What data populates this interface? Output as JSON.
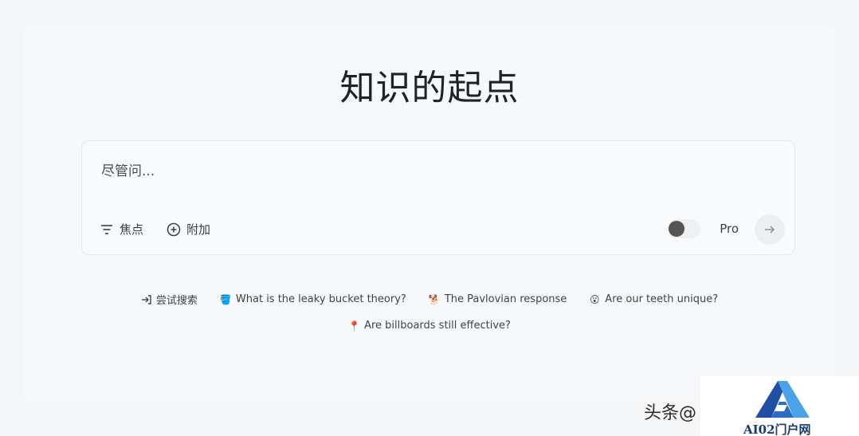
{
  "header": {
    "title": "知识的起点"
  },
  "search": {
    "placeholder": "尽管问...",
    "value": "",
    "focus_label": "焦点",
    "attach_label": "附加",
    "pro_label": "Pro"
  },
  "suggestions": {
    "try_label": "尝试搜索",
    "items": [
      {
        "emoji": "🪣",
        "label": "What is the leaky bucket theory?"
      },
      {
        "emoji": "🐕",
        "label": "The Pavlovian response"
      },
      {
        "emoji": "😮",
        "label": "Are our teeth unique?"
      },
      {
        "emoji": "📍",
        "label": "Are billboards still effective?"
      }
    ]
  },
  "watermark": {
    "toutiao": "头条@",
    "logo_text": "AI02门户网"
  },
  "colors": {
    "background": "#f5f6f7",
    "toggle_knob": "#555555",
    "logo_blue": "#1e4fa3",
    "logo_light": "#4aa3e8"
  }
}
